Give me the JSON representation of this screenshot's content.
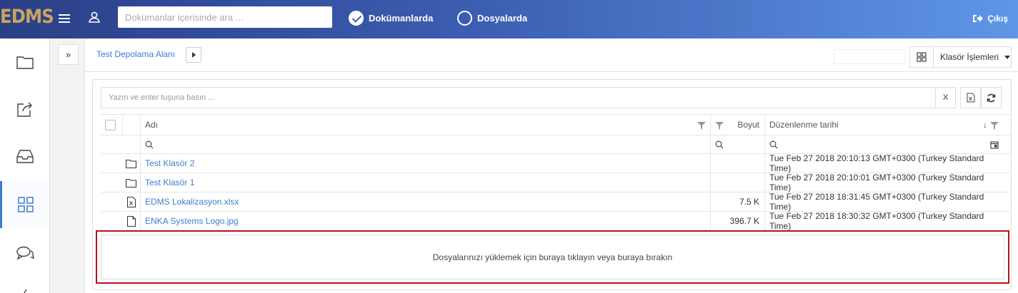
{
  "brand": "EDMS",
  "header": {
    "search_placeholder": "Dokümanlar içerisinde ara ...",
    "radio_documents": "Dokümanlarda",
    "radio_files": "Dosyalarda",
    "logout": "Çıkış"
  },
  "breadcrumb": {
    "current": "Test Depolama Alanı"
  },
  "toolbar": {
    "folder_actions": "Klasör İşlemleri"
  },
  "filter": {
    "placeholder": "Yazın ve enter tuşuna basın ...",
    "clear": "X"
  },
  "table": {
    "columns": {
      "name": "Adı",
      "size": "Boyut",
      "modified": "Düzenlenme tarihi"
    },
    "rows": [
      {
        "icon": "folder-icon",
        "name": "Test Klasör 2",
        "size": "",
        "modified": "Tue Feb 27 2018 20:10:13 GMT+0300 (Turkey Standard Time)"
      },
      {
        "icon": "folder-icon",
        "name": "Test Klasör 1",
        "size": "",
        "modified": "Tue Feb 27 2018 20:10:01 GMT+0300 (Turkey Standard Time)"
      },
      {
        "icon": "excel-file-icon",
        "name": "EDMS Lokalizasyon.xlsx",
        "size": "7.5 K",
        "modified": "Tue Feb 27 2018 18:31:45 GMT+0300 (Turkey Standard Time)"
      },
      {
        "icon": "file-icon",
        "name": "ENKA Systems Logo.jpg",
        "size": "396.7 K",
        "modified": "Tue Feb 27 2018 18:30:32 GMT+0300 (Turkey Standard Time)"
      }
    ]
  },
  "dropzone": {
    "text": "Dosyalarınızı yüklemek için buraya tıklayın veya buraya bırakın"
  },
  "colors": {
    "header_start": "#2a3f86",
    "header_end": "#5f96e6",
    "link": "#3b7ecf",
    "highlight_border": "#b5121b",
    "brand": "#c8a45c"
  }
}
